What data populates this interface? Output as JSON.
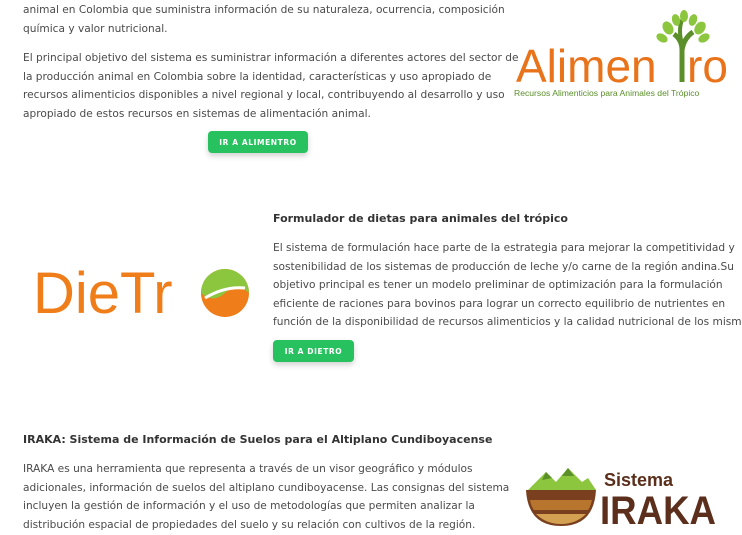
{
  "alimentro": {
    "lines_top": [
      "animal en Colombia que suministra información de su naturaleza, ocurrencia, composición",
      "química y valor nutricional."
    ],
    "lines": [
      "El principal objetivo del sistema es suministrar información a diferentes actores del sector de",
      "la producción animal en Colombia sobre la identidad, características y uso apropiado de",
      "recursos alimenticios disponibles a nivel regional y local, contribuyendo al desarrollo y uso",
      "apropiado de estos recursos en sistemas de alimentación animal."
    ],
    "button_label": "IR A ALIMENTRO",
    "logo_text": "Alimentro",
    "logo_subtitle": "Recursos Alimenticios para Animales del Trópico"
  },
  "dietro": {
    "title": "Formulador de dietas para animales del trópico",
    "lines": [
      "El sistema de formulación hace parte de la estrategia para mejorar la competitividad y",
      "sostenibilidad de los sistemas de producción de leche y/o carne de la región andina.Su",
      "objetivo principal es tener un modelo preliminar de optimización para la formulación",
      "eficiente de raciones para bovinos para lograr un correcto equilibrio de nutrientes en",
      "función de la disponibilidad de recursos alimenticios y la calidad nutricional de los mismos."
    ],
    "button_label": "IR A DIETRO",
    "logo_text": "DieTr"
  },
  "iraka": {
    "title": "IRAKA: Sistema de Información de Suelos para el Altiplano Cundiboyacense",
    "lines": [
      "IRAKA es una herramienta que representa a través de un visor geográfico y módulos",
      "adicionales, información de suelos del altiplano cundiboyacense. Las consignas del sistema",
      "incluyen la gestión de información y el uso de metodologías que permiten analizar la",
      "distribución espacial de propiedades del suelo y su relación con cultivos de la región."
    ],
    "logo_line1": "Sistema",
    "logo_line2": "IRAKA"
  },
  "colors": {
    "button": "#27c25f",
    "alimentro_orange": "#e8731a",
    "alimentro_green": "#8cc63f",
    "dietro_orange": "#ef7d1a",
    "iraka_brown": "#5b2f1c"
  }
}
